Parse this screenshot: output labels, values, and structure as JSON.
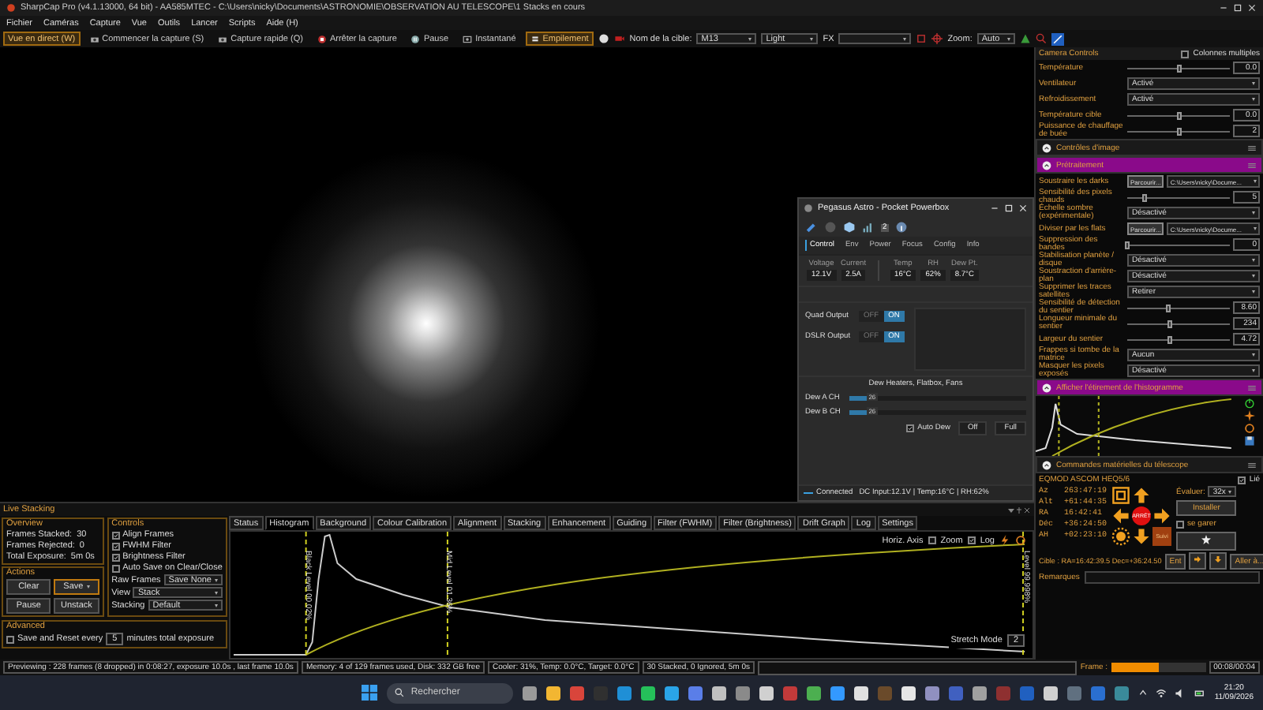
{
  "window": {
    "title": "SharpCap Pro (v4.1.13000, 64 bit) - AA585MTEC - C:\\Users\\nicky\\Documents\\ASTRONOMIE\\OBSERVATION AU TELESCOPE\\1 Stacks en cours"
  },
  "menu": [
    "Fichier",
    "Caméras",
    "Capture",
    "Vue",
    "Outils",
    "Lancer",
    "Scripts",
    "Aide (H)"
  ],
  "toolbar": {
    "buttons": [
      {
        "label": "Vue en direct (W)",
        "selected": true
      },
      {
        "label": "Commencer la capture (S)",
        "selected": false
      },
      {
        "label": "Capture rapide (Q)",
        "selected": false
      },
      {
        "label": "Arrêter la capture",
        "selected": false
      },
      {
        "label": "Pause",
        "selected": false
      },
      {
        "label": "Instantané",
        "selected": false
      },
      {
        "label": "Empilement",
        "selected": true
      }
    ],
    "target_label": "Nom de la cible:",
    "target": "M13",
    "frame_type": "Light",
    "fx_label": "FX",
    "zoom_label": "Zoom:",
    "zoom": "Auto"
  },
  "pegasus": {
    "title": "Pegasus Astro - Pocket Powerbox",
    "toolbar_badge": "2",
    "tabs": [
      {
        "label": "Control",
        "selected": true
      },
      {
        "label": "Env",
        "selected": false
      },
      {
        "label": "Power",
        "selected": false
      },
      {
        "label": "Focus",
        "selected": false
      },
      {
        "label": "Config",
        "selected": false
      },
      {
        "label": "Info",
        "selected": false
      }
    ],
    "readings": [
      {
        "label": "Voltage",
        "value": "12.1V"
      },
      {
        "label": "Current",
        "value": "2.5A"
      },
      {
        "label": "Temp",
        "value": "16°C"
      },
      {
        "label": "RH",
        "value": "62%"
      },
      {
        "label": "Dew Pt.",
        "value": "8.7°C"
      }
    ],
    "outputs": [
      {
        "label": "Quad Output",
        "off_label": "OFF",
        "on_label": "ON",
        "on": true
      },
      {
        "label": "DSLR Output",
        "off_label": "OFF",
        "on_label": "ON",
        "on": true
      }
    ],
    "dew_title": "Dew Heaters, Flatbox, Fans",
    "dew": [
      {
        "label": "Dew A CH",
        "level": 0.1,
        "reading": "26"
      },
      {
        "label": "Dew B CH",
        "level": 0.1,
        "reading": "26"
      }
    ],
    "auto_dew": {
      "label": "Auto Dew",
      "checked": true
    },
    "buttons": [
      "Off",
      "Full"
    ],
    "status": {
      "label": "Connected",
      "info": "DC Input:12.1V | Temp:16°C | RH:62%"
    }
  },
  "live_stacking": {
    "title": "Live Stacking",
    "overview": {
      "title": "Overview",
      "rows": [
        {
          "label": "Frames Stacked:",
          "value": "30"
        },
        {
          "label": "Frames Rejected:",
          "value": "0"
        },
        {
          "label": "Total Exposure:",
          "value": "5m 0s"
        }
      ]
    },
    "actions": {
      "title": "Actions",
      "buttons": [
        "Clear",
        "Save",
        "Pause",
        "Unstack"
      ]
    },
    "advanced": {
      "title": "Advanced",
      "checkbox": {
        "label": "Save and Reset every",
        "checked": false
      },
      "minutes": "5",
      "suffix": "minutes total exposure"
    },
    "controls": {
      "title": "Controls",
      "checks": [
        {
          "label": "Align Frames",
          "checked": true
        },
        {
          "label": "FWHM Filter",
          "checked": true
        },
        {
          "label": "Brightness Filter",
          "checked": true
        },
        {
          "label": "Auto Save on Clear/Close",
          "checked": false
        }
      ],
      "selects": [
        {
          "label": "Raw Frames",
          "value": "Save None"
        },
        {
          "label": "View",
          "value": "Stack"
        },
        {
          "label": "Stacking",
          "value": "Default"
        }
      ]
    },
    "tabs": [
      {
        "label": "Status",
        "selected": false
      },
      {
        "label": "Histogram",
        "selected": true
      },
      {
        "label": "Background",
        "selected": false
      },
      {
        "label": "Colour Calibration",
        "selected": false
      },
      {
        "label": "Alignment",
        "selected": false
      },
      {
        "label": "Stacking",
        "selected": false
      },
      {
        "label": "Enhancement",
        "selected": false
      },
      {
        "label": "Guiding",
        "selected": false
      },
      {
        "label": "Filter (FWHM)",
        "selected": false
      },
      {
        "label": "Filter (Brightness)",
        "selected": false
      },
      {
        "label": "Drift Graph",
        "selected": false
      },
      {
        "label": "Log",
        "selected": false
      },
      {
        "label": "Settings",
        "selected": false
      }
    ],
    "histogram": {
      "markers": [
        "Black Level 00.02%",
        "Mid Level 01.36%",
        "Level 99.998%"
      ],
      "axis_label": "Horiz. Axis",
      "options": [
        {
          "label": "Zoom",
          "checked": false
        },
        {
          "label": "Log",
          "checked": true
        }
      ],
      "stretch_label": "Stretch Mode",
      "stretch_value": "2"
    }
  },
  "right_panel": {
    "header": {
      "title": "Camera Controls",
      "option": {
        "label": "Colonnes multiples",
        "checked": false
      }
    },
    "camera_rows": [
      {
        "kind": "slider",
        "label": "Température",
        "level": 0.5,
        "value": "0.0"
      },
      {
        "kind": "dropdown",
        "label": "Ventilateur",
        "value": "Activé"
      },
      {
        "kind": "dropdown",
        "label": "Refroidissement",
        "value": "Activé"
      },
      {
        "kind": "slider",
        "label": "Température cible",
        "level": 0.5,
        "value": "0.0"
      },
      {
        "kind": "slider",
        "label": "Puissance de chauffage de buée",
        "level": 0.5,
        "value": "2"
      }
    ],
    "sections": [
      {
        "title": "Contrôles d'image",
        "highlighted": false
      },
      {
        "title": "Prétraitement",
        "highlighted": true,
        "rows": [
          {
            "kind": "browse",
            "label": "Soustraire les darks",
            "button": "Parcourir...",
            "value": "C:\\Users\\nicky\\Docume..."
          },
          {
            "kind": "slider",
            "label": "Sensibilité des pixels chauds",
            "level": 0.17,
            "value": "5"
          },
          {
            "kind": "dropdown",
            "label": "Échelle sombre (expérimentale)",
            "value": "Désactivé"
          },
          {
            "kind": "browse",
            "label": "Diviser par les flats",
            "button": "Parcourir...",
            "value": "C:\\Users\\nicky\\Docume..."
          },
          {
            "kind": "slider",
            "label": "Suppression des bandes",
            "level": 0,
            "value": "0"
          },
          {
            "kind": "dropdown",
            "label": "Stabilisation planète / disque",
            "value": "Désactivé"
          },
          {
            "kind": "dropdown",
            "label": "Soustraction d'arrière-plan",
            "value": "Désactivé"
          },
          {
            "kind": "dropdown",
            "label": "Supprimer les traces satellites",
            "value": "Retirer"
          },
          {
            "kind": "slider",
            "label": "Sensibilité de détection du sentier",
            "level": 0.4,
            "value": "8.60"
          },
          {
            "kind": "slider",
            "label": "Longueur minimale du sentier",
            "level": 0.42,
            "value": "234"
          },
          {
            "kind": "slider",
            "label": "Largeur du sentier",
            "level": 0.42,
            "value": "4.72"
          },
          {
            "kind": "dropdown",
            "label": "Frappes si tombe de la matrice",
            "value": "Aucun"
          },
          {
            "kind": "dropdown",
            "label": "Masquer les pixels exposés",
            "value": "Désactivé"
          }
        ]
      }
    ],
    "histogram": {
      "title": "Afficher l'étirement de l'histogramme",
      "highlighted": true
    },
    "telescope": {
      "title": "Commandes matérielles du télescope",
      "highlighted": false,
      "mount": "EQMOD ASCOM HEQ5/6",
      "linked": {
        "label": "Lié",
        "checked": true
      },
      "coords": [
        {
          "label": "Az",
          "value": "263:47:19"
        },
        {
          "label": "Alt",
          "value": "+61:44:35"
        },
        {
          "label": "RA",
          "value": "16:42:41"
        },
        {
          "label": "Déc",
          "value": "+36:24:50"
        },
        {
          "label": "AH",
          "value": "+02:23:10"
        }
      ],
      "stop": "ARRÊT",
      "rate_label": "Évaluer:",
      "rate": "32x",
      "install": "Installer",
      "park": {
        "label": "se garer",
        "checked": false
      },
      "track": "Suivi",
      "target": "Cible : RA=16:42:39.5 Dec=+36:24.50",
      "enter": "Ent",
      "goto": "Aller à...",
      "notes_label": "Remarques"
    }
  },
  "status_bar": {
    "segments": [
      "Previewing : 228 frames (8 dropped) in 0:08:27, exposure 10.0s , last frame 10.0s",
      "Memory: 4 of 129 frames used, Disk: 332 GB free",
      "Cooler: 31%, Temp: 0.0°C, Target: 0.0°C",
      "30 Stacked, 0 Ignored, 5m 0s"
    ],
    "frame_label": "Frame :",
    "frame": {
      "level": 0.5
    },
    "time": "00:08/00:04"
  },
  "taskbar": {
    "search": "Rechercher",
    "apps": [
      {
        "color": "#9a9a9a"
      },
      {
        "color": "#f2b632"
      },
      {
        "color": "#d9453b"
      },
      {
        "color": "#303030"
      },
      {
        "color": "#1f8fd6"
      },
      {
        "color": "#25c05a"
      },
      {
        "color": "#2aa4e8"
      },
      {
        "color": "#5a7ee8"
      },
      {
        "color": "#c0c0c0"
      },
      {
        "color": "#8a8a8a"
      },
      {
        "color": "#d0d0d0"
      },
      {
        "color": "#c23a3a"
      },
      {
        "color": "#4caf50"
      },
      {
        "color": "#3399ff"
      },
      {
        "color": "#e0e0e0"
      },
      {
        "color": "#6a4a2a"
      },
      {
        "color": "#e6e6e6"
      },
      {
        "color": "#9090c0"
      },
      {
        "color": "#4060c0"
      },
      {
        "color": "#a0a0a0"
      },
      {
        "color": "#8e3030"
      },
      {
        "color": "#2060c0"
      },
      {
        "color": "#d0d0d0"
      },
      {
        "color": "#607080"
      },
      {
        "color": "#2a6fd0"
      },
      {
        "color": "#3a8a9a"
      }
    ],
    "clock": {
      "time": "21:20",
      "date": "11/09/2026"
    }
  }
}
